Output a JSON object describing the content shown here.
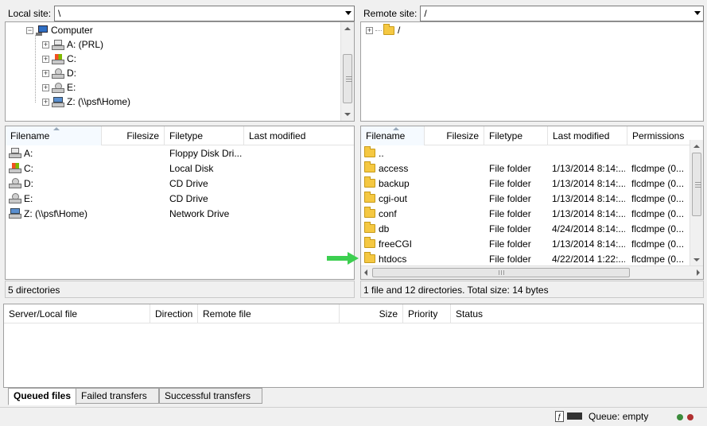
{
  "local": {
    "site_label": "Local site:",
    "site_path": "\\",
    "tree": [
      {
        "label": "Computer",
        "icon": "computer-icon"
      },
      {
        "label": "A: (PRL)",
        "icon": "floppy-drive-icon"
      },
      {
        "label": "C:",
        "icon": "local-disk-icon"
      },
      {
        "label": "D:",
        "icon": "cd-drive-icon"
      },
      {
        "label": "E:",
        "icon": "cd-drive-icon"
      },
      {
        "label": "Z: (\\\\psf\\Home)",
        "icon": "network-drive-icon"
      }
    ],
    "columns": [
      "Filename",
      "Filesize",
      "Filetype",
      "Last modified"
    ],
    "rows": [
      {
        "name": "A:",
        "size": "",
        "type": "Floppy Disk Dri...",
        "modified": "",
        "icon": "floppy-drive-icon"
      },
      {
        "name": "C:",
        "size": "",
        "type": "Local Disk",
        "modified": "",
        "icon": "local-disk-icon"
      },
      {
        "name": "D:",
        "size": "",
        "type": "CD Drive",
        "modified": "",
        "icon": "cd-drive-icon"
      },
      {
        "name": "E:",
        "size": "",
        "type": "CD Drive",
        "modified": "",
        "icon": "cd-drive-icon"
      },
      {
        "name": "Z: (\\\\psf\\Home)",
        "size": "",
        "type": "Network Drive",
        "modified": "",
        "icon": "network-drive-icon"
      }
    ],
    "status": "5 directories"
  },
  "remote": {
    "site_label": "Remote site:",
    "site_path": "/",
    "tree": [
      {
        "label": "/",
        "icon": "folder-icon"
      }
    ],
    "columns": [
      "Filename",
      "Filesize",
      "Filetype",
      "Last modified",
      "Permissions"
    ],
    "rows": [
      {
        "name": "..",
        "size": "",
        "type": "",
        "modified": "",
        "perms": ""
      },
      {
        "name": "access",
        "size": "",
        "type": "File folder",
        "modified": "1/13/2014 8:14:...",
        "perms": "flcdmpe (0..."
      },
      {
        "name": "backup",
        "size": "",
        "type": "File folder",
        "modified": "1/13/2014 8:14:...",
        "perms": "flcdmpe (0..."
      },
      {
        "name": "cgi-out",
        "size": "",
        "type": "File folder",
        "modified": "1/13/2014 8:14:...",
        "perms": "flcdmpe (0..."
      },
      {
        "name": "conf",
        "size": "",
        "type": "File folder",
        "modified": "1/13/2014 8:14:...",
        "perms": "flcdmpe (0..."
      },
      {
        "name": "db",
        "size": "",
        "type": "File folder",
        "modified": "4/24/2014 8:14:...",
        "perms": "flcdmpe (0..."
      },
      {
        "name": "freeCGI",
        "size": "",
        "type": "File folder",
        "modified": "1/13/2014 8:14:...",
        "perms": "flcdmpe (0..."
      },
      {
        "name": "htdocs",
        "size": "",
        "type": "File folder",
        "modified": "4/22/2014 1:22:...",
        "perms": "flcdmpe (0..."
      }
    ],
    "status": "1 file and 12 directories. Total size: 14 bytes"
  },
  "queue": {
    "columns": [
      "Server/Local file",
      "Direction",
      "Remote file",
      "Size",
      "Priority",
      "Status"
    ],
    "tabs": [
      "Queued files",
      "Failed transfers",
      "Successful transfers"
    ],
    "active_tab": 0
  },
  "statusbar": {
    "queue_text": "Queue: empty",
    "icons": [
      "filter-icon",
      "binary-mode-icon"
    ],
    "led_colors": [
      "#3c8c3c",
      "#b03030"
    ]
  },
  "colors": {
    "accent_arrow": "#3ccf50",
    "folder": "#f5c842"
  }
}
